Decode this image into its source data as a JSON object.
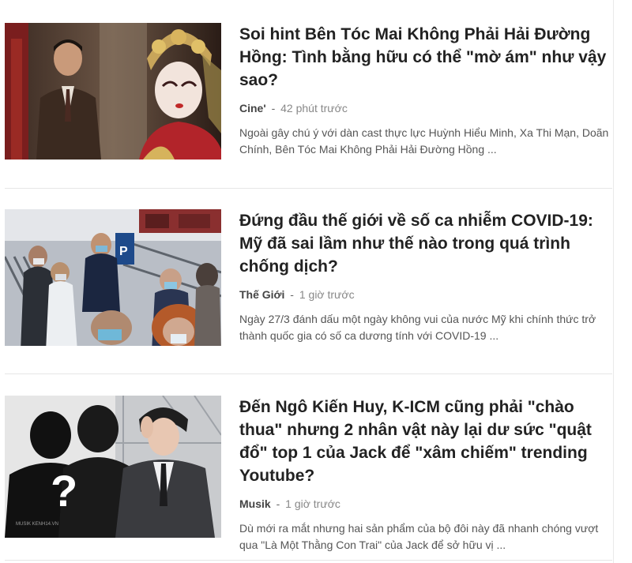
{
  "articles": [
    {
      "title": "Soi hint Bên Tóc Mai Không Phải Hải Đường Hồng: Tình bằng hữu có thể \"mờ ám\" như vậy sao?",
      "category": "Cine'",
      "separator": "-",
      "time": "42 phút trước",
      "excerpt": "Ngoài gây chú ý với dàn cast thực lực Huỳnh Hiểu Minh, Xa Thi Mạn, Doãn Chính, Bên Tóc Mai Không Phải Hải Đường Hồng ..."
    },
    {
      "title": "Đứng đầu thế giới về số ca nhiễm COVID-19: Mỹ đã sai lầm như thế nào trong quá trình chống dịch?",
      "category": "Thế Giới",
      "separator": "-",
      "time": "1 giờ trước",
      "excerpt": "Ngày 27/3 đánh dấu một ngày không vui của nước Mỹ khi chính thức trở thành quốc gia có số ca dương tính với COVID-19 ...",
      "image_sign": "P"
    },
    {
      "title": "Đến Ngô Kiến Huy, K-ICM cũng phải \"chào thua\" nhưng 2 nhân vật này lại dư sức \"quật đổ\" top 1 của Jack để \"xâm chiếm\" trending Youtube?",
      "category": "Musik",
      "separator": "-",
      "time": "1 giờ trước",
      "excerpt": "Dù mới ra mắt nhưng hai sản phẩm của bộ đôi này đã nhanh chóng vượt qua \"Là Một Thằng Con Trai\" của Jack để sở hữu vị ...",
      "image_mark": "?",
      "watermark": "MUSIK KENH14.VN"
    }
  ]
}
